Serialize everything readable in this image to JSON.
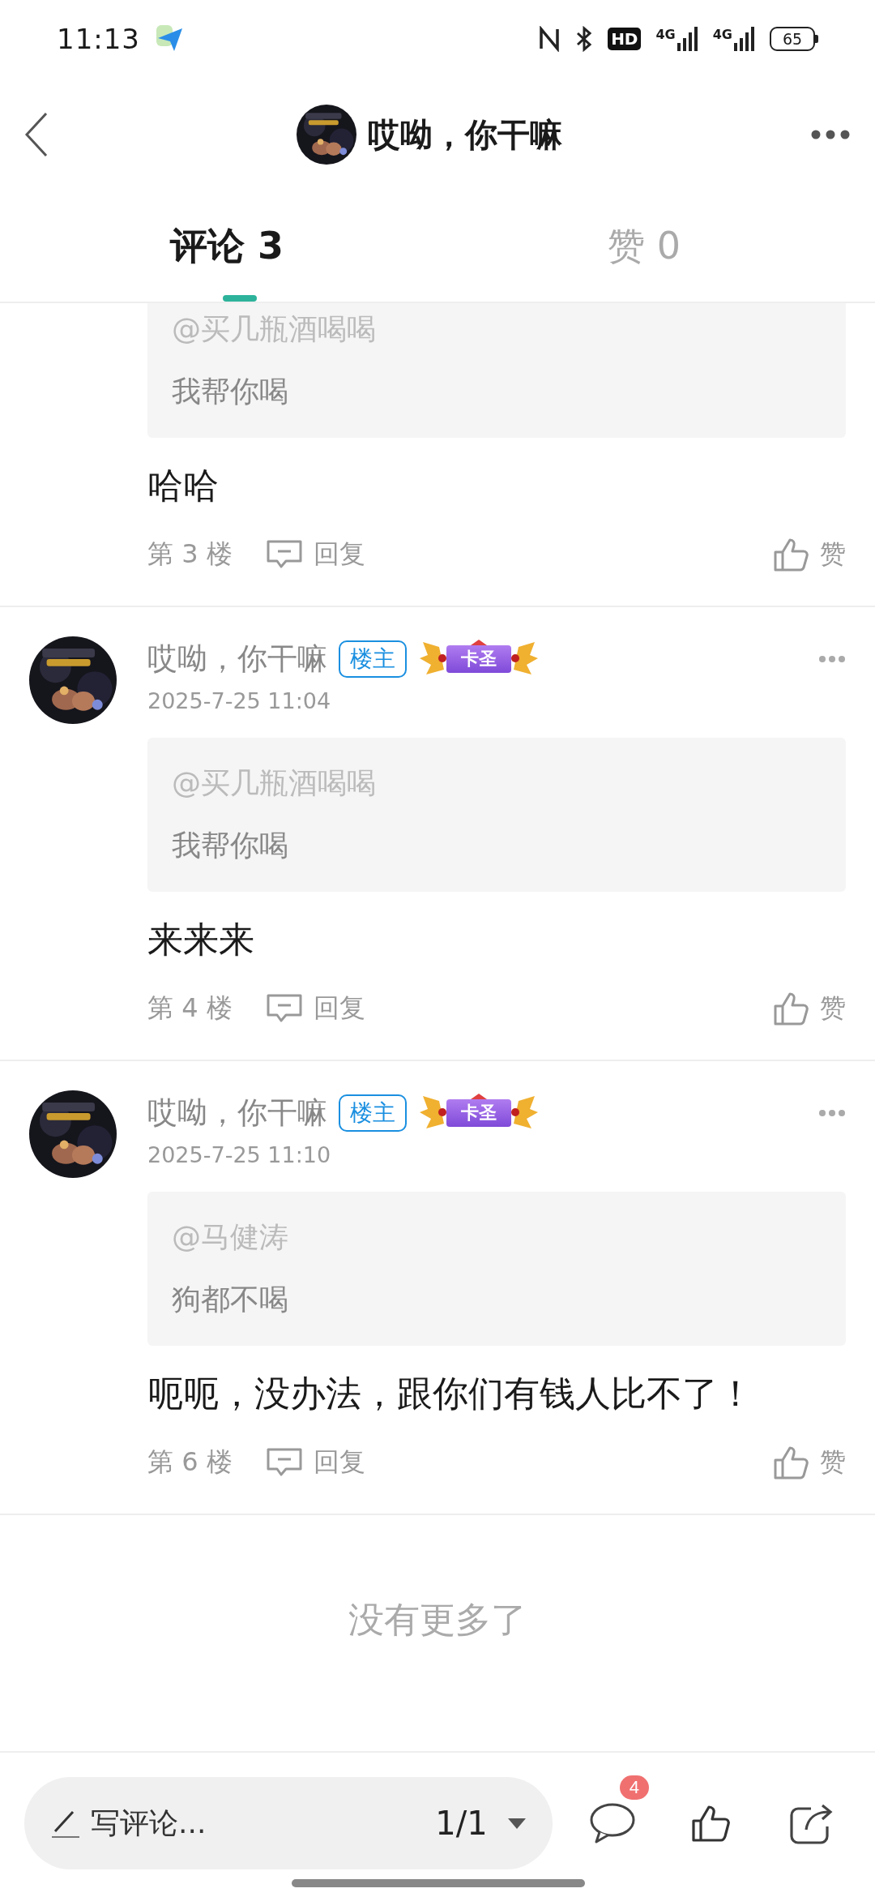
{
  "status_bar": {
    "time": "11:13",
    "hd": "HD",
    "networks": [
      "4G",
      "4G"
    ],
    "battery": "65"
  },
  "header": {
    "title": "哎呦，你干嘛"
  },
  "tabs": [
    {
      "label": "评论 3",
      "selected": true
    },
    {
      "label": "赞 0",
      "selected": false
    }
  ],
  "comments": [
    {
      "quote_user": "@买几瓶酒喝喝",
      "quote_text": "我帮你喝",
      "text": "哈哈",
      "floor": "第 3 楼",
      "reply": "回复",
      "like": "赞"
    },
    {
      "author": "哎呦，你干嘛",
      "host_tag": "楼主",
      "badge": "卡圣",
      "time": "2025-7-25 11:04",
      "quote_user": "@买几瓶酒喝喝",
      "quote_text": "我帮你喝",
      "text": "来来来",
      "floor": "第 4 楼",
      "reply": "回复",
      "like": "赞"
    },
    {
      "author": "哎呦，你干嘛",
      "host_tag": "楼主",
      "badge": "卡圣",
      "time": "2025-7-25 11:10",
      "quote_user": "@马健涛",
      "quote_text": "狗都不喝",
      "text": "呃呃，没办法，跟你们有钱人比不了！",
      "floor": "第 6 楼",
      "reply": "回复",
      "like": "赞"
    }
  ],
  "end_note": "没有更多了",
  "bottom_bar": {
    "placeholder": "写评论...",
    "page": "1/1",
    "comment_count": "4"
  }
}
